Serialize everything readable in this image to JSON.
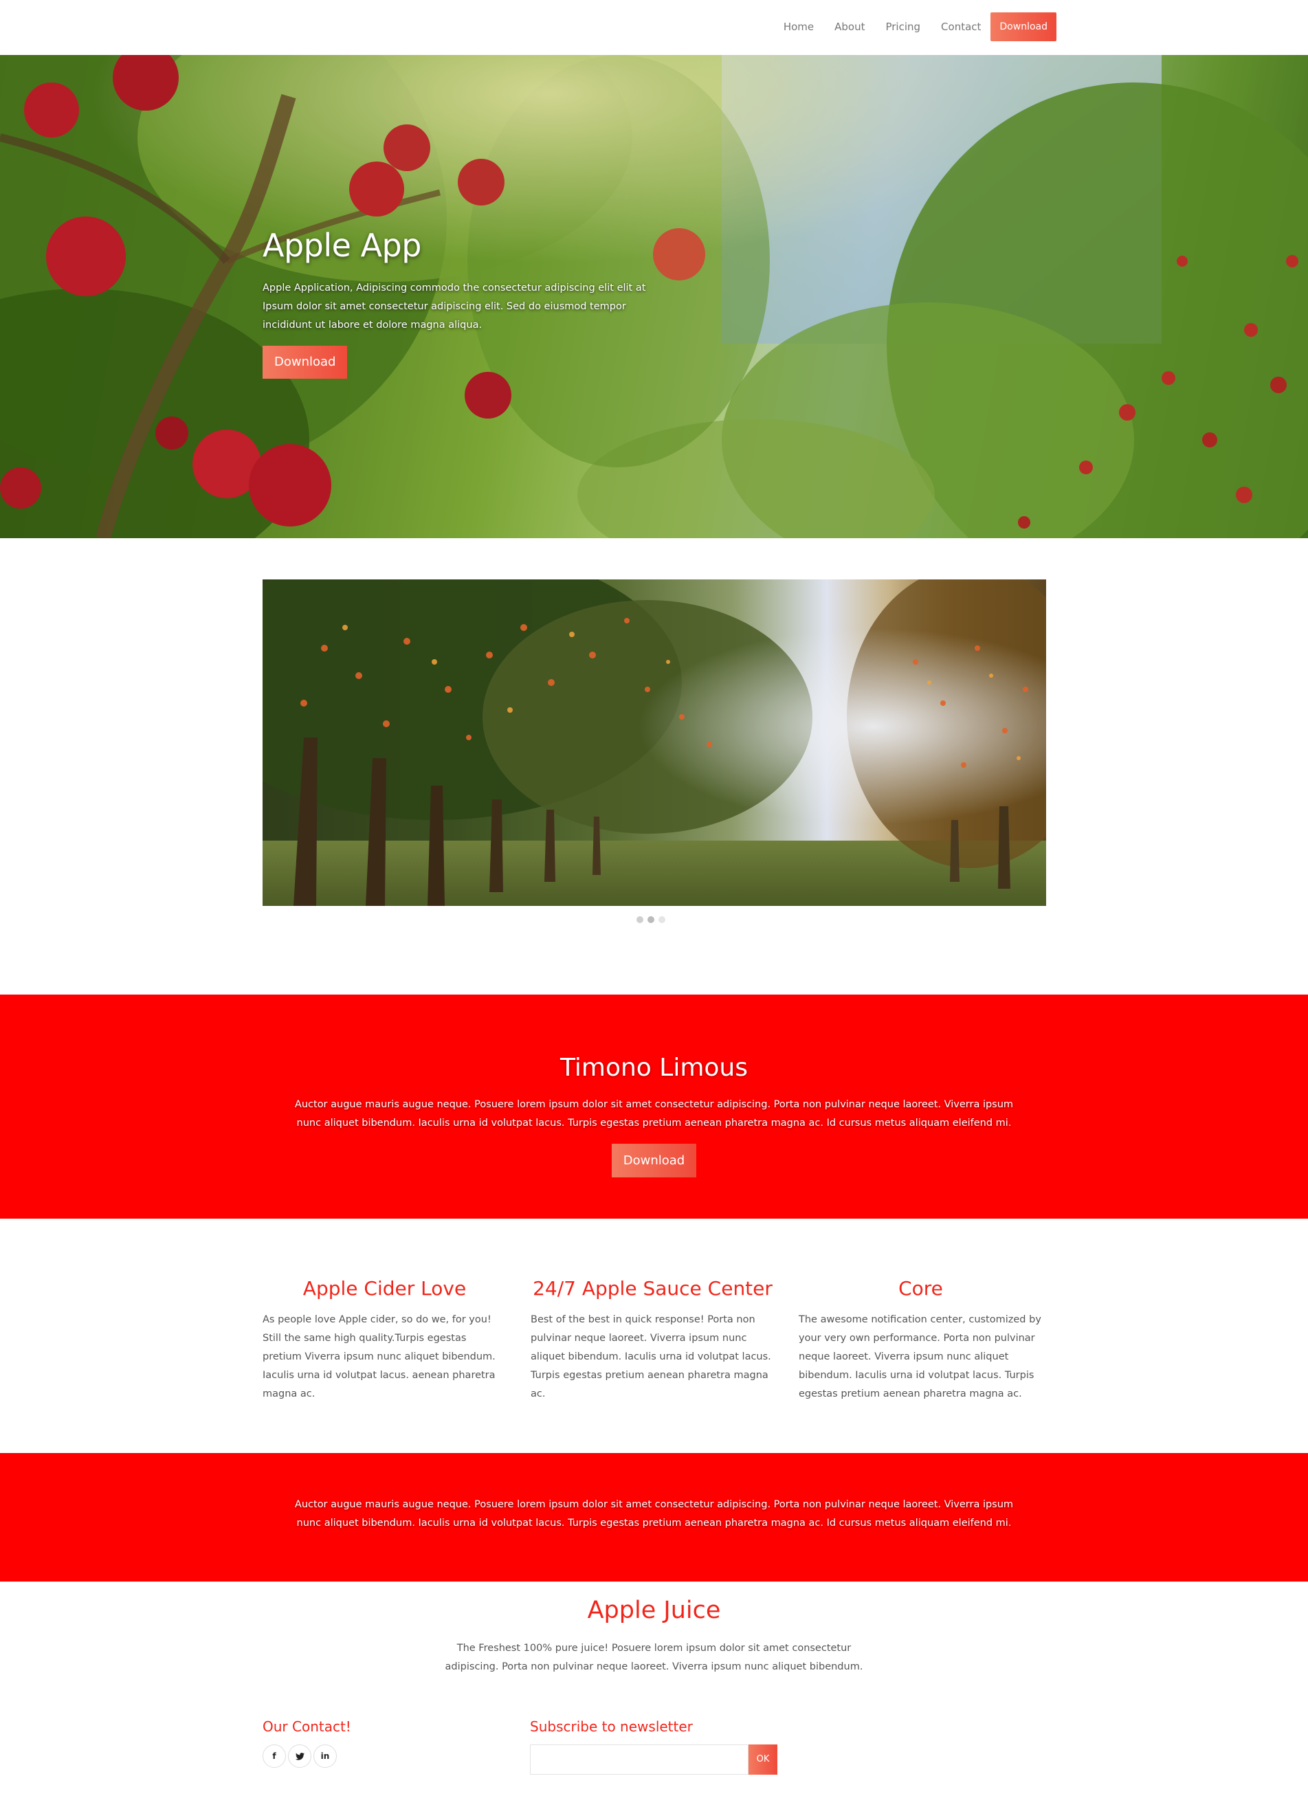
{
  "nav": {
    "links": [
      "Home",
      "About",
      "Pricing",
      "Contact"
    ],
    "download_label": "Download"
  },
  "hero": {
    "title": "Apple App",
    "description": "Apple Application, Adipiscing commodo the consectetur adipiscing elit elit at Ipsum dolor sit amet consectetur adipiscing elit. Sed do eiusmod tempor incididunt ut labore et dolore magna aliqua.",
    "button_label": "Download"
  },
  "slider": {
    "dots": 3,
    "active_index": 1
  },
  "band1": {
    "title": "Timono Limous",
    "text": "Auctor augue mauris augue neque. Posuere lorem ipsum dolor sit amet consectetur adipiscing. Porta non pulvinar neque laoreet. Viverra ipsum nunc aliquet bibendum. Iaculis urna id volutpat lacus. Turpis egestas pretium aenean pharetra magna ac. Id cursus metus aliquam eleifend mi.",
    "button_label": "Download"
  },
  "features": [
    {
      "title": "Apple Cider Love",
      "text": "As people love Apple cider, so do we, for you! Still the same high quality.Turpis egestas pretium Viverra ipsum nunc aliquet bibendum. Iaculis urna id volutpat lacus. aenean pharetra magna ac."
    },
    {
      "title": "24/7 Apple Sauce Center",
      "text": "Best of the best in quick response! Porta non pulvinar neque laoreet. Viverra ipsum nunc aliquet bibendum. Iaculis urna id volutpat lacus. Turpis egestas pretium aenean pharetra magna ac."
    },
    {
      "title": "Core",
      "text": "The awesome notification center, customized by your very own performance. Porta non pulvinar neque laoreet. Viverra ipsum nunc aliquet bibendum. Iaculis urna id volutpat lacus. Turpis egestas pretium aenean pharetra magna ac."
    }
  ],
  "band2": {
    "text": "Auctor augue mauris augue neque. Posuere lorem ipsum dolor sit amet consectetur adipiscing. Porta non pulvinar neque laoreet. Viverra ipsum nunc aliquet bibendum. Iaculis urna id volutpat lacus. Turpis egestas pretium aenean pharetra magna ac. Id cursus metus aliquam eleifend mi."
  },
  "juice": {
    "title": "Apple Juice",
    "text": "The Freshest 100% pure juice! Posuere lorem ipsum dolor sit amet consectetur adipiscing. Porta non pulvinar neque laoreet. Viverra ipsum nunc aliquet bibendum."
  },
  "footer": {
    "contact_title": "Our Contact!",
    "socials": [
      {
        "icon": "facebook-icon",
        "glyph": "f"
      },
      {
        "icon": "twitter-icon",
        "glyph": "❧"
      },
      {
        "icon": "linkedin-icon",
        "glyph": "in"
      }
    ],
    "newsletter_title": "Subscribe to newsletter",
    "newsletter_placeholder": "",
    "newsletter_button": "OK"
  },
  "colors": {
    "accent_red": "#ff0000",
    "heading_red": "#f0261b",
    "button_gradient_start": "#f37b60",
    "button_gradient_end": "#ef4a3a"
  }
}
